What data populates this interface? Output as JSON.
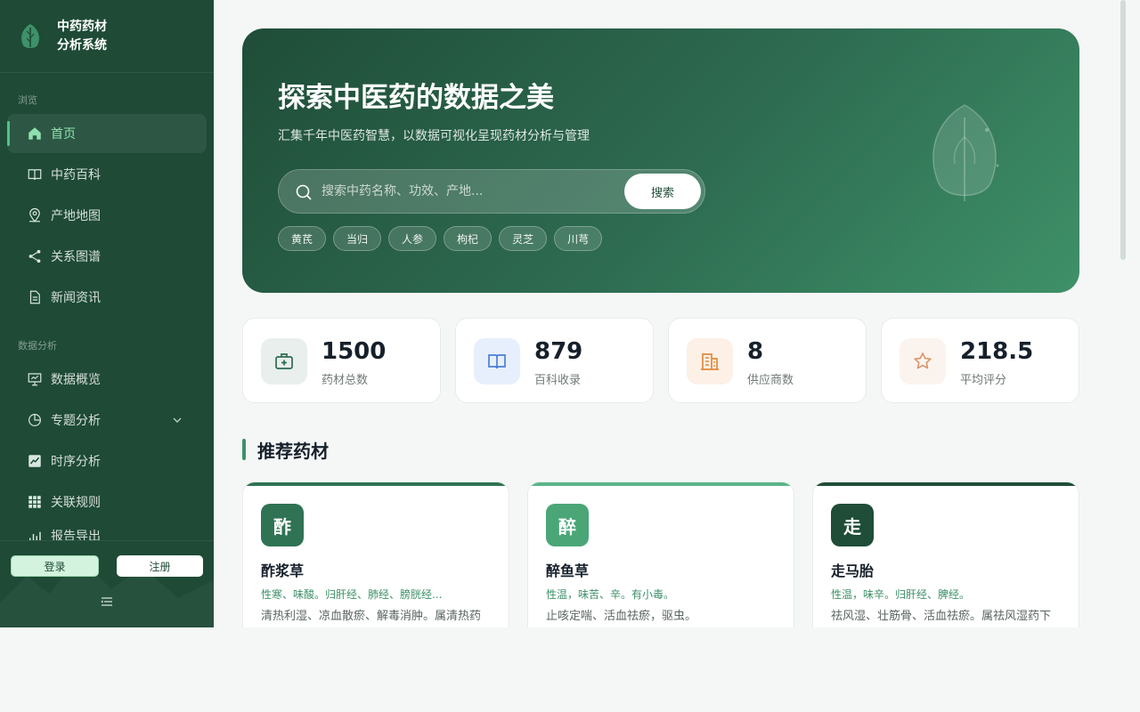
{
  "app": {
    "title_line1": "中药药材",
    "title_line2": "分析系统"
  },
  "sidebar": {
    "section_browse": "浏览",
    "browse_items": [
      {
        "label": "首页",
        "icon": "home-icon",
        "active": true
      },
      {
        "label": "中药百科",
        "icon": "book-icon"
      },
      {
        "label": "产地地图",
        "icon": "map-pin-icon"
      },
      {
        "label": "关系图谱",
        "icon": "share-icon"
      },
      {
        "label": "新闻资讯",
        "icon": "document-icon"
      }
    ],
    "section_analysis": "数据分析",
    "analysis_items": [
      {
        "label": "数据概览",
        "icon": "presentation-icon"
      },
      {
        "label": "专题分析",
        "icon": "pie-chart-icon",
        "has_submenu": true
      },
      {
        "label": "时序分析",
        "icon": "line-chart-icon"
      },
      {
        "label": "关联规则",
        "icon": "grid-icon"
      },
      {
        "label": "报告导出",
        "icon": "bar-chart-icon"
      }
    ],
    "login_label": "登录",
    "register_label": "注册"
  },
  "hero": {
    "title": "探索中医药的数据之美",
    "subtitle": "汇集千年中医药智慧，以数据可视化呈现药材分析与管理",
    "search_placeholder": "搜索中药名称、功效、产地...",
    "search_button": "搜索",
    "tags": [
      "黄芪",
      "当归",
      "人参",
      "枸杞",
      "灵芝",
      "川芎"
    ]
  },
  "stats": [
    {
      "value": "1500",
      "label": "药材总数",
      "icon": "medicine-kit-icon",
      "bg": "#e8efec",
      "color": "#2e6c51"
    },
    {
      "value": "879",
      "label": "百科收录",
      "icon": "book-icon",
      "bg": "#e8effc",
      "color": "#4a7fd8"
    },
    {
      "value": "8",
      "label": "供应商数",
      "icon": "building-icon",
      "bg": "#fdf0e6",
      "color": "#e08a3c"
    },
    {
      "value": "218.5",
      "label": "平均评分",
      "icon": "star-icon",
      "bg": "#fbf3ee",
      "color": "#d9956a"
    }
  ],
  "recommend": {
    "title": "推荐药材",
    "cards": [
      {
        "badge": "酢",
        "name": "酢浆草",
        "props": "性寒、味酸。归肝经、肺经、膀胱经...",
        "desc": "清热利湿、凉血散瘀、解毒消肿。属清热药",
        "badge_color": "#2f7354",
        "bar": "#2f7354"
      },
      {
        "badge": "醉",
        "name": "醉鱼草",
        "props": "性温，味苦、辛。有小毒。",
        "desc": "止咳定喘、活血祛瘀，驱虫。",
        "badge_color": "#4aa677",
        "bar": "#5bb589"
      },
      {
        "badge": "走",
        "name": "走马胎",
        "props": "性温，味辛。归肝经、脾经。",
        "desc": "祛风湿、壮筋骨、活血祛瘀。属祛风湿药下",
        "badge_color": "#1f4d38",
        "bar": "#1f4d38"
      }
    ]
  }
}
